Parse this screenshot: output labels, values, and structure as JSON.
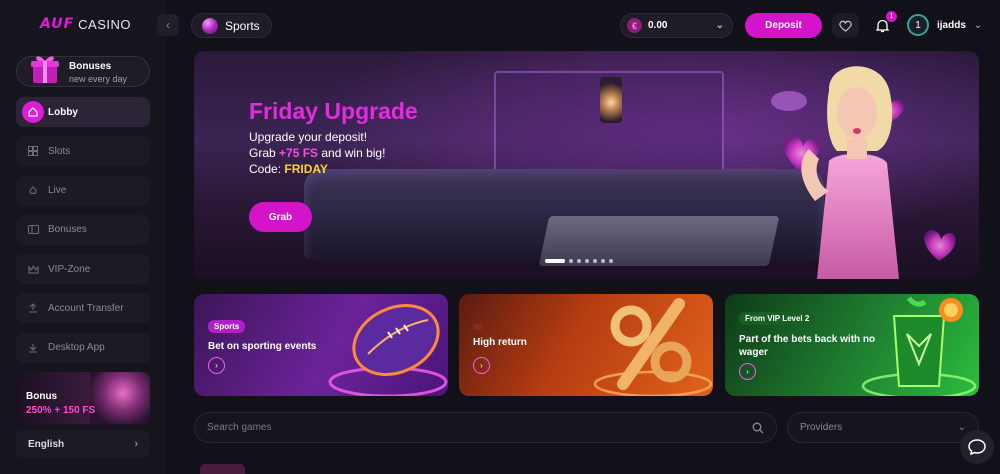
{
  "brand": {
    "logo_text": "AUF",
    "casino_text": "CASINO"
  },
  "sidebar": {
    "bonus_card": {
      "title": "Bonuses",
      "subtitle": "new every day"
    },
    "items": [
      {
        "label": "Lobby",
        "icon": "home-icon",
        "active": true
      },
      {
        "label": "Slots",
        "icon": "grid-icon",
        "active": false
      },
      {
        "label": "Live",
        "icon": "spade-icon",
        "active": false
      },
      {
        "label": "Bonuses",
        "icon": "ticket-icon",
        "active": false
      },
      {
        "label": "VIP-Zone",
        "icon": "crown-icon",
        "active": false
      },
      {
        "label": "Account Transfer",
        "icon": "upload-icon",
        "active": false
      },
      {
        "label": "Desktop App",
        "icon": "download-icon",
        "active": false
      }
    ],
    "promo": {
      "line1": "Bonus",
      "line2": "250% + 150 FS"
    },
    "language": "English"
  },
  "header": {
    "sports_label": "Sports",
    "balance": "0.00",
    "currency_symbol": "€",
    "deposit_label": "Deposit",
    "notifications_count": "1",
    "user_level": "1",
    "username": "ijadds"
  },
  "hero": {
    "title": "Friday Upgrade",
    "line1": "Upgrade your deposit!",
    "line2_prefix": "Grab ",
    "line2_highlight": "+75 FS",
    "line2_suffix": " and win big!",
    "line3_prefix": "Code: ",
    "line3_code": "FRIDAY",
    "cta_label": "Grab",
    "slides_total": 7,
    "active_slide": 1
  },
  "cards": [
    {
      "tag": "Sports",
      "title": "Bet on sporting events"
    },
    {
      "tag": "",
      "title": "High return"
    },
    {
      "tag": "From VIP Level 2",
      "title": "Part of the bets back with no wager"
    }
  ],
  "search": {
    "placeholder": "Search games"
  },
  "providers": {
    "label": "Providers"
  },
  "colors": {
    "accent": "#d414c9",
    "bg": "#121018",
    "sidebar": "#16141d",
    "highlight_yellow": "#ffd23a"
  }
}
